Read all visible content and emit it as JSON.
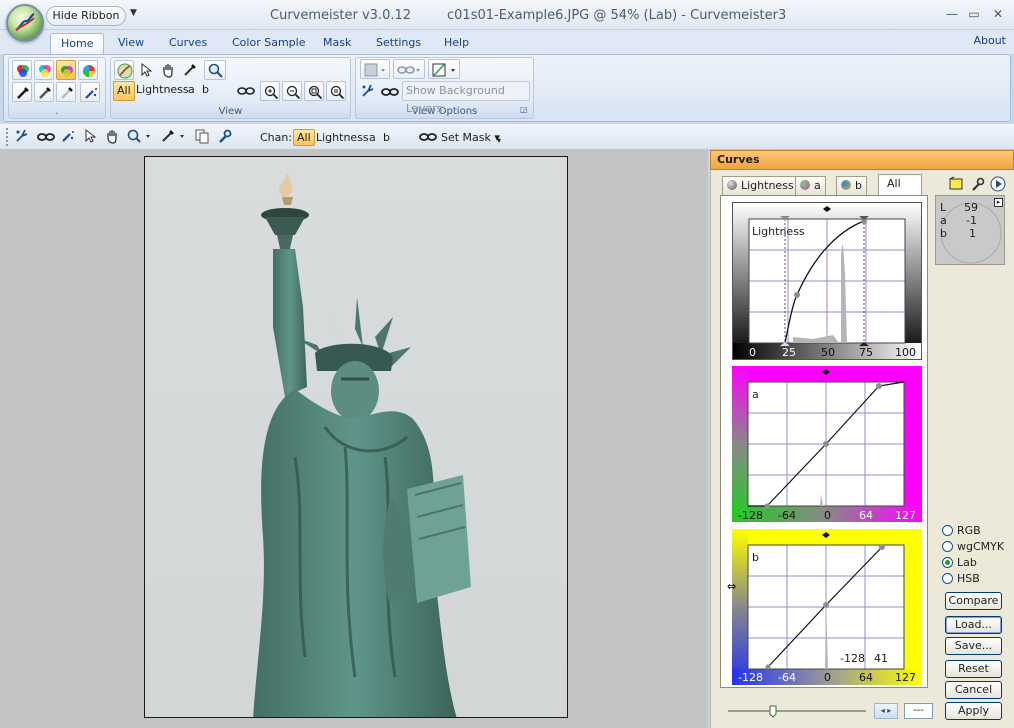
{
  "window": {
    "app_title": "Curvemeister v3.0.12",
    "document_title": "c01s01-Example6.JPG @ 54% (Lab)  -  Curvemeister3",
    "hide_ribbon_label": "Hide Ribbon",
    "controls": {
      "minimize": "—",
      "maximize": "▭",
      "close": "✕"
    }
  },
  "menu_tabs": [
    "Home",
    "View",
    "Curves",
    "Color Sample",
    "Mask",
    "Settings",
    "Help"
  ],
  "active_tab": "Home",
  "about_label": "About",
  "ribbon": {
    "group1_label": ".",
    "view_group": {
      "label": "View",
      "channels": [
        "All",
        "Lightness",
        "a",
        "b"
      ],
      "selected": "All"
    },
    "view_options_group": {
      "label": "View Options",
      "show_bg_label": "Show Background Layers"
    }
  },
  "toolbar2": {
    "chan_label": "Chan:",
    "channels": [
      "All",
      "Lightness",
      "a",
      "b"
    ],
    "selected": "All",
    "set_mask_label": "Set Mask"
  },
  "curves_panel": {
    "title": "Curves",
    "tabs": [
      {
        "label": "Lightness",
        "dot": "#6a6a6a"
      },
      {
        "label": "a",
        "dot": "#c53fb5"
      },
      {
        "label": "b",
        "dot": "#c9b62b"
      },
      {
        "label": "All",
        "dot": ""
      }
    ],
    "active_tab": "All",
    "graphs": [
      {
        "name": "Lightness",
        "ticks": [
          "0",
          "25",
          "50",
          "75",
          "100"
        ]
      },
      {
        "name": "a",
        "ticks": [
          "-128",
          "-64",
          "0",
          "64",
          "127"
        ]
      },
      {
        "name": "b",
        "ticks": [
          "-128",
          "-64",
          "0",
          "64",
          "127"
        ],
        "readout_in": "-128",
        "readout_out": "41"
      }
    ],
    "info": {
      "rows": [
        {
          "k": "L",
          "v": "59"
        },
        {
          "k": "a",
          "v": "-1"
        },
        {
          "k": "b",
          "v": "1"
        }
      ]
    },
    "color_modes": [
      "RGB",
      "wgCMYK",
      "Lab",
      "HSB"
    ],
    "selected_mode": "Lab",
    "buttons": [
      "Compare",
      "Load...",
      "Save...",
      "Reset",
      "Cancel",
      "Apply"
    ],
    "apply_label": "Apply",
    "value_field": "---"
  }
}
